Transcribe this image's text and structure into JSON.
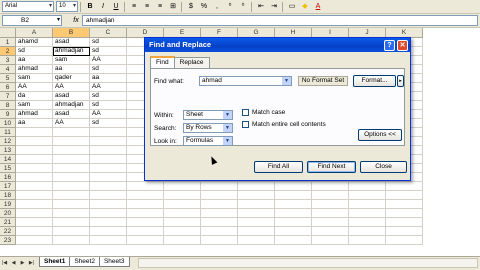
{
  "toolbar": {
    "font_name": "Arial",
    "font_size": "10",
    "buttons": [
      "B",
      "I",
      "U",
      "≡",
      "≡",
      "≡",
      "⊞",
      "$",
      "%",
      ",",
      "⁰",
      "⁰",
      "⇤",
      "⇥",
      "▭",
      "A"
    ]
  },
  "formula_bar": {
    "name_box": "B2",
    "fx": "fx",
    "content": "ahmadjan"
  },
  "columns": [
    "A",
    "B",
    "C",
    "D",
    "E",
    "F",
    "G",
    "H",
    "I",
    "J",
    "K"
  ],
  "rows": [
    "1",
    "2",
    "3",
    "4",
    "5",
    "6",
    "7",
    "8",
    "9",
    "10",
    "11",
    "12",
    "13",
    "14",
    "15",
    "16",
    "17",
    "18",
    "19",
    "20",
    "21",
    "22",
    "23"
  ],
  "cells": [
    [
      "ahamd",
      "asad",
      "sd"
    ],
    [
      "sd",
      "ahmadjan",
      "sd"
    ],
    [
      "aa",
      "sam",
      "AA"
    ],
    [
      "ahmad",
      "aa",
      "sd"
    ],
    [
      "sam",
      "qader",
      "aa"
    ],
    [
      "AA",
      "AA",
      "AA"
    ],
    [
      "da",
      "asad",
      "sd"
    ],
    [
      "sam",
      "ahmadjan",
      "sd"
    ],
    [
      "ahmad",
      "asad",
      "AA"
    ],
    [
      "aa",
      "AA",
      "sd"
    ]
  ],
  "sheet_tabs": [
    "Sheet1",
    "Sheet2",
    "Sheet3"
  ],
  "dialog": {
    "title": "Find and Replace",
    "help": "?",
    "close": "✕",
    "tabs": [
      "Find",
      "Replace"
    ],
    "find_label": "Find what:",
    "find_value": "ahmad",
    "format_status": "No Format Set",
    "format_button": "Format...",
    "within_label": "Within:",
    "within_value": "Sheet",
    "search_label": "Search:",
    "search_value": "By Rows",
    "lookin_label": "Look in:",
    "lookin_value": "Formulas",
    "match_case": "Match case",
    "match_entire": "Match entire cell contents",
    "options_button": "Options <<",
    "find_all": "Find All",
    "find_next": "Find Next",
    "close_button": "Close"
  }
}
